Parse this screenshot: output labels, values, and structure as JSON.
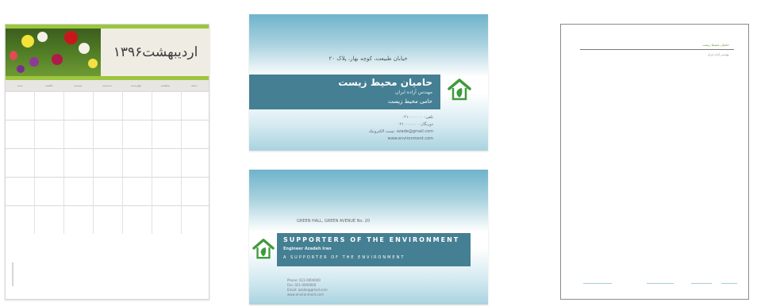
{
  "calendar": {
    "month_title": "اردیبهشت۱۳۹۶",
    "day_names": [
      "شنبه",
      "یکشنبه",
      "دوشنبه",
      "سه‌شنبه",
      "چهارشنبه",
      "پنجشنبه",
      "جمعه"
    ],
    "accent_color": "#9bc63d"
  },
  "card_front": {
    "address": "خیابان طبیعت، کوچه بهار، پلاک ۲۰",
    "company": "حامیان محیط زیست",
    "person": "مهندس آزاده ایران",
    "role": "حامی محیط زیست",
    "contacts": [
      "تلفن: ۰۲۱۰۰۰۰۰۰۰",
      "دورنگار: ۰۲۱۰۰۰۰۰۰۰",
      "پست الکترونیک: azade@gmail.com",
      "www.environment.com"
    ],
    "band_color": "#457f93"
  },
  "card_back": {
    "address": "GREEN HALL, GREEN AVENUE No. 20",
    "company": "SUPPORTERS OF THE ENVIRONMENT",
    "person": "Engineer Azadeh Iran",
    "role": "A SUPPORTER OF THE ENVIRONMENT",
    "contacts": [
      "Phone: 021-0000000",
      "Fax: 021-0000000",
      "Email: azade@gmail.com",
      "www.environment.com"
    ]
  },
  "letterhead": {
    "title": "حامیان محیط زیست",
    "subtitle": "مهندس آزاده ایران"
  },
  "icons": {
    "house": "house-leaf-icon"
  }
}
